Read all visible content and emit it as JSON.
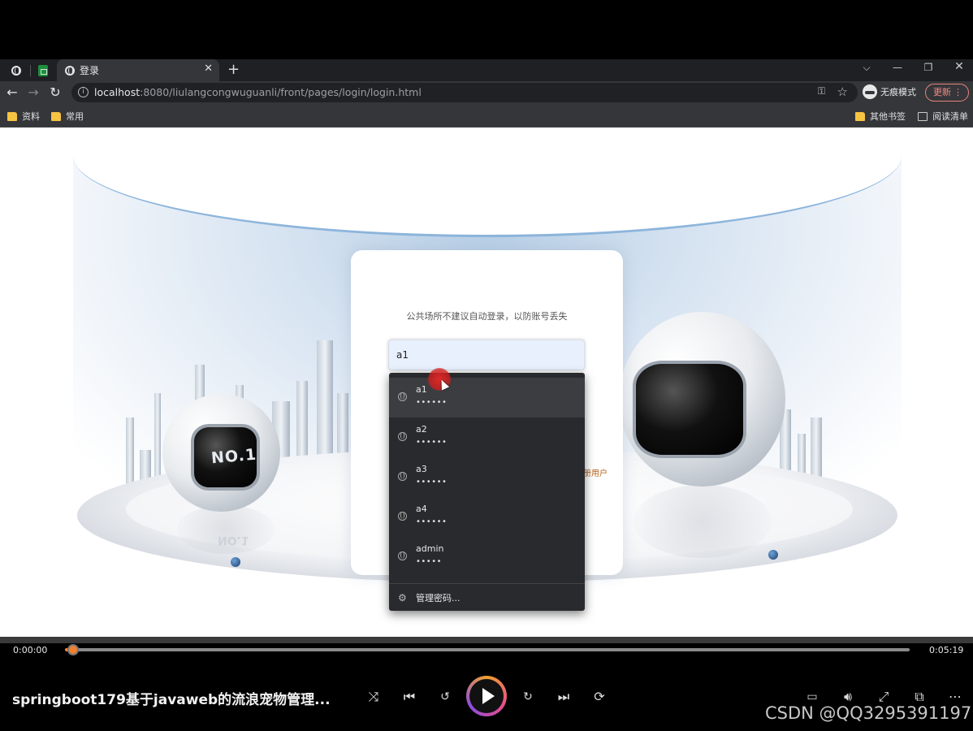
{
  "browser": {
    "active_tab_title": "登录",
    "new_tab": "+",
    "url_host": "localhost",
    "url_path": ":8080/liulangcongwuguanli/front/pages/login/login.html",
    "incognito_label": "无痕模式",
    "update_label": "更新",
    "bookmarks": [
      "资料",
      "常用"
    ],
    "bookmarks_right": [
      "其他书签",
      "阅读清单"
    ]
  },
  "login": {
    "notice": "公共场所不建议自动登录，以防账号丢失",
    "username_value": "a1",
    "register_partial": "册用户",
    "robot_label": "NO.1"
  },
  "autofill": {
    "items": [
      {
        "user": "a1",
        "password": "••••••"
      },
      {
        "user": "a2",
        "password": "••••••"
      },
      {
        "user": "a3",
        "password": "••••••"
      },
      {
        "user": "a4",
        "password": "••••••"
      },
      {
        "user": "admin",
        "password": "•••••"
      }
    ],
    "manage_label": "管理密码..."
  },
  "player": {
    "current_time": "0:00:00",
    "duration": "0:05:19",
    "progress": 0.005,
    "title": "springboot179基于javaweb的流浪宠物管理...",
    "watermark": "CSDN @QQ3295391197"
  },
  "colors": {
    "accent": "#f08030",
    "tab_active": "#35363a",
    "autofill_bg": "#292a2d"
  }
}
